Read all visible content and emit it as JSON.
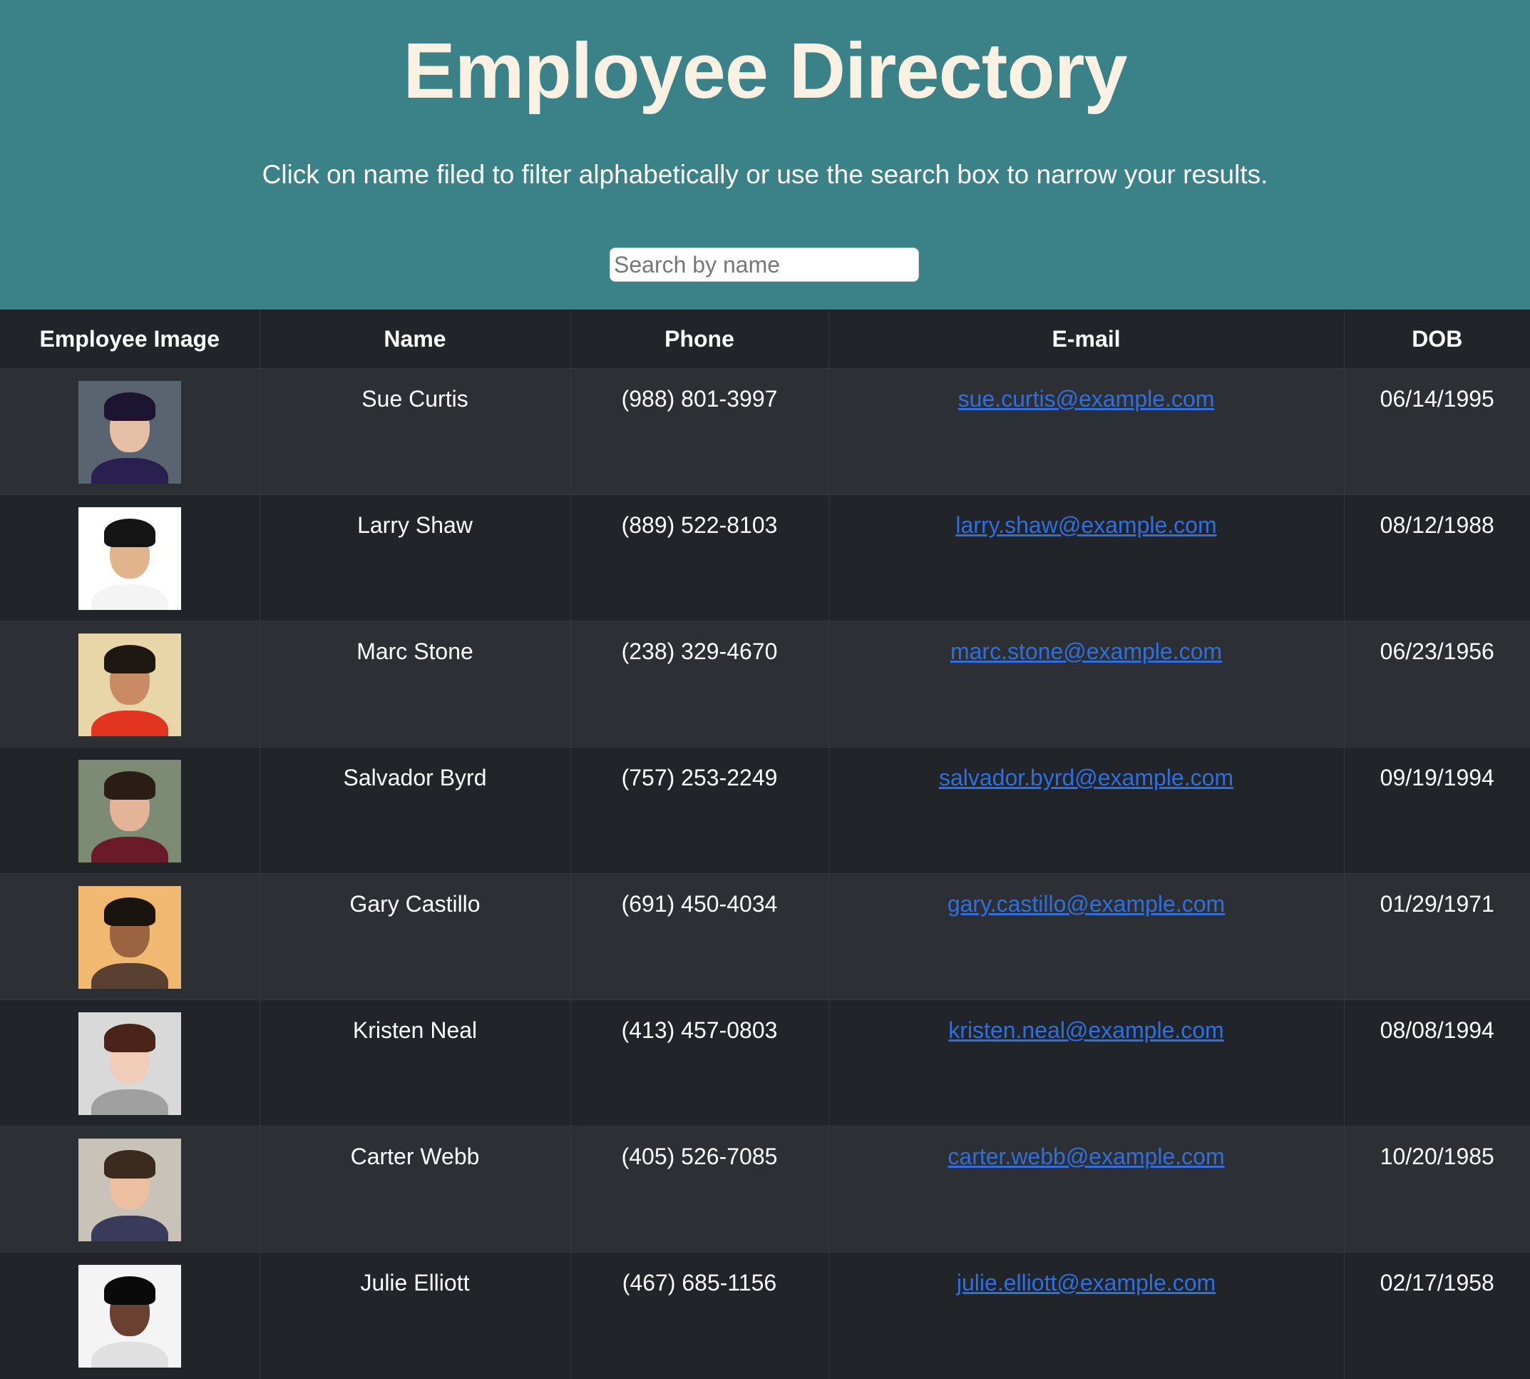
{
  "header": {
    "title": "Employee Directory",
    "subtitle": "Click on name filed to filter alphabetically or use the search box to narrow your results.",
    "search_placeholder": "Search by name",
    "background": "#3a8188",
    "title_color": "#fbf1e2"
  },
  "table": {
    "columns": [
      "Employee Image",
      "Name",
      "Phone",
      "E-mail",
      "DOB"
    ],
    "link_color": "#2f6fe0",
    "rows": [
      {
        "name": "Sue Curtis",
        "phone": "(988) 801-3997",
        "email": "sue.curtis@example.com",
        "dob": "06/14/1995",
        "avatar": {
          "bg": "#5a6470",
          "skin": "#e6c0a6",
          "hair": "#1c1430",
          "shirt": "#2a2050"
        }
      },
      {
        "name": "Larry Shaw",
        "phone": "(889) 522-8103",
        "email": "larry.shaw@example.com",
        "dob": "08/12/1988",
        "avatar": {
          "bg": "#ffffff",
          "skin": "#e2b48e",
          "hair": "#151515",
          "shirt": "#f4f4f4"
        }
      },
      {
        "name": "Marc Stone",
        "phone": "(238) 329-4670",
        "email": "marc.stone@example.com",
        "dob": "06/23/1956",
        "avatar": {
          "bg": "#e8d6a8",
          "skin": "#c98b64",
          "hair": "#1e1812",
          "shirt": "#e2341f"
        }
      },
      {
        "name": "Salvador Byrd",
        "phone": "(757) 253-2249",
        "email": "salvador.byrd@example.com",
        "dob": "09/19/1994",
        "avatar": {
          "bg": "#7d8a74",
          "skin": "#e3b497",
          "hair": "#2a1d16",
          "shirt": "#6b1a2a"
        }
      },
      {
        "name": "Gary Castillo",
        "phone": "(691) 450-4034",
        "email": "gary.castillo@example.com",
        "dob": "01/29/1971",
        "avatar": {
          "bg": "#f0b870",
          "skin": "#9a6440",
          "hair": "#1a1410",
          "shirt": "#5a4030"
        }
      },
      {
        "name": "Kristen Neal",
        "phone": "(413) 457-0803",
        "email": "kristen.neal@example.com",
        "dob": "08/08/1994",
        "avatar": {
          "bg": "#d9d9d9",
          "skin": "#f0cdb8",
          "hair": "#4a2418",
          "shirt": "#a0a0a0"
        }
      },
      {
        "name": "Carter Webb",
        "phone": "(405) 526-7085",
        "email": "carter.webb@example.com",
        "dob": "10/20/1985",
        "avatar": {
          "bg": "#c8c2b8",
          "skin": "#eac0a0",
          "hair": "#3a2a1e",
          "shirt": "#3a3a5a"
        }
      },
      {
        "name": "Julie Elliott",
        "phone": "(467) 685-1156",
        "email": "julie.elliott@example.com",
        "dob": "02/17/1958",
        "avatar": {
          "bg": "#f4f4f4",
          "skin": "#6a4030",
          "hair": "#0a0a0a",
          "shirt": "#e0e0e0"
        }
      }
    ]
  }
}
